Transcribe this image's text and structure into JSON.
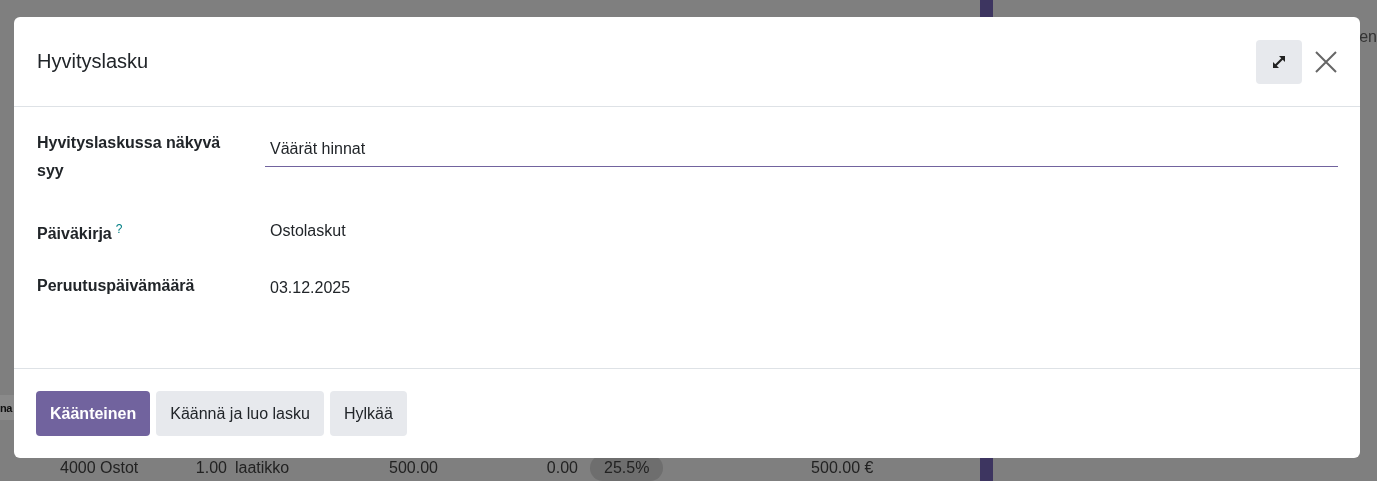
{
  "background": {
    "side_text": "na",
    "panel_text": "en",
    "row": {
      "cells": [
        "4000 Ostot",
        "1.00",
        "laatikko",
        "500.00",
        "0.00"
      ],
      "tax_tag": "25.5%",
      "total": "500.00 €"
    }
  },
  "dialog": {
    "title": "Hyvityslasku",
    "fields": [
      {
        "kind": "input",
        "label": "Hyvityslaskussa näkyvä syy",
        "value": "Väärät hinnat"
      },
      {
        "kind": "text",
        "label": "Päiväkirja",
        "help_mark": "?",
        "value": "Ostolaskut"
      },
      {
        "kind": "text",
        "label": "Peruutuspäivämäärä",
        "value": "03.12.2025"
      }
    ],
    "buttons": [
      {
        "label": "Käänteinen",
        "primary": true
      },
      {
        "label": "Käännä ja luo lasku",
        "primary": false
      },
      {
        "label": "Hylkää",
        "primary": false
      }
    ]
  }
}
